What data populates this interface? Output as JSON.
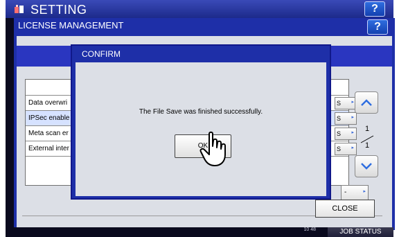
{
  "app": {
    "title": "SETTING",
    "help_label": "?"
  },
  "license_window": {
    "title": "LICENSE MANAGEMENT",
    "help_label": "?"
  },
  "list": {
    "rows": [
      {
        "label": "",
        "button": ""
      },
      {
        "label": "Data overwri",
        "button": "S"
      },
      {
        "label": "IPSec enable",
        "button": "S"
      },
      {
        "label": "Meta scan er",
        "button": "S"
      },
      {
        "label": "External inter",
        "button": "S"
      },
      {
        "label": "",
        "button": ""
      }
    ],
    "lower_button": "-"
  },
  "pager": {
    "current": "1",
    "total": "1"
  },
  "dialog": {
    "title": "CONFIRM",
    "message": "The File Save was finished successfully.",
    "ok_label": "OK"
  },
  "footer": {
    "close_label": "CLOSE"
  },
  "status_bar": {
    "time_top": "",
    "time_bottom": "10 48",
    "job_status_label": "JOB STATUS"
  }
}
